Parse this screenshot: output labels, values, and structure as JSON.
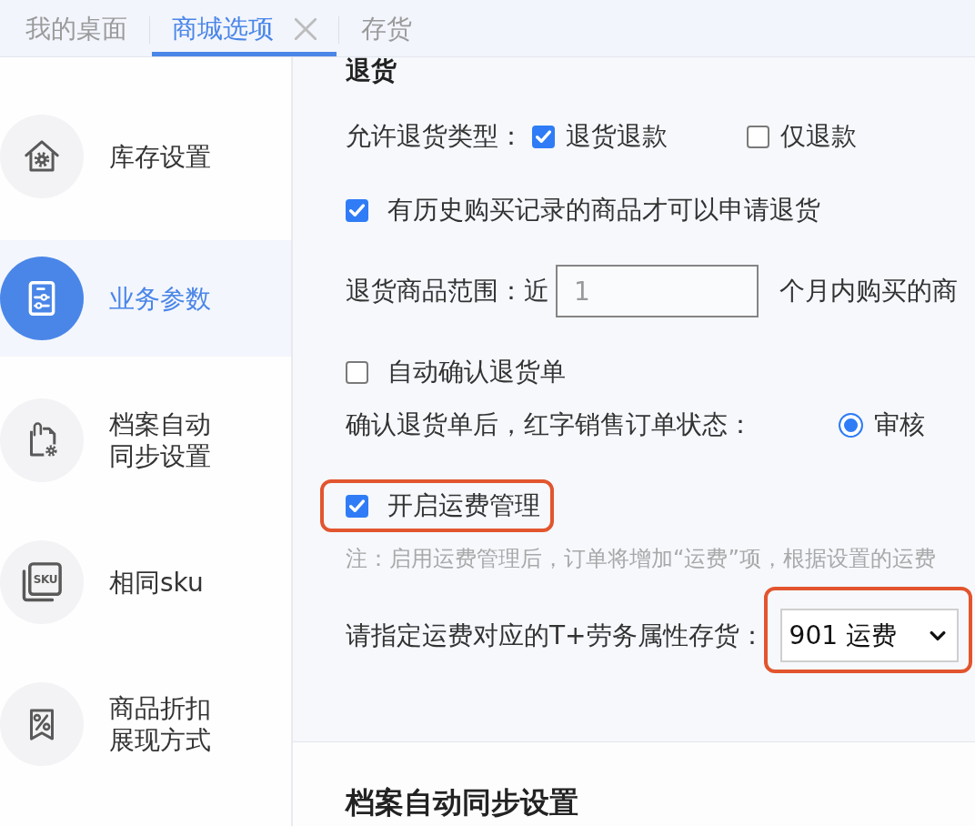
{
  "tabs": [
    {
      "label": "我的桌面",
      "selected": false,
      "closable": false
    },
    {
      "label": "商城选项",
      "selected": true,
      "closable": true
    },
    {
      "label": "存货",
      "selected": false,
      "closable": false
    }
  ],
  "sidebar": {
    "items": [
      {
        "label": "库存设置",
        "selected": false
      },
      {
        "label": "业务参数",
        "selected": true
      },
      {
        "label": "档案自动同步设置",
        "selected": false
      },
      {
        "label": "相同sku",
        "icon_text": "SKU",
        "selected": false
      },
      {
        "label": "商品折扣展现方式",
        "selected": false
      }
    ]
  },
  "section": {
    "title": "退货",
    "rows": [
      {
        "kind": "checkbox-group",
        "label": "允许退货类型：",
        "highlighted": false,
        "options": [
          {
            "label": "退货退款",
            "checked": true
          },
          {
            "label": "仅退款",
            "checked": false
          }
        ]
      },
      {
        "kind": "checkbox",
        "label": "有历史购买记录的商品才可以申请退货",
        "checked": true,
        "highlighted": false
      },
      {
        "kind": "input",
        "label": "退货商品范围：近",
        "value": "1",
        "suffix": "个月内购买的商",
        "highlighted": false
      },
      {
        "kind": "checkbox",
        "label": "自动确认退货单",
        "checked": false,
        "highlighted": false
      },
      {
        "kind": "radio-group",
        "label": "确认退货单后，红字销售订单状态：",
        "highlighted": false,
        "options": [
          {
            "label": "审核",
            "selected": true
          }
        ]
      },
      {
        "kind": "checkbox",
        "label": "开启运费管理",
        "checked": true,
        "highlighted": true
      },
      {
        "kind": "note",
        "text": "注：启用运费管理后，订单将增加“运费”项，根据设置的运费"
      },
      {
        "kind": "select",
        "label": "请指定运费对应的T+劳务属性存货：",
        "value": "901 运费",
        "highlighted": true
      }
    ]
  },
  "next_section": {
    "title": "档案自动同步设置"
  }
}
